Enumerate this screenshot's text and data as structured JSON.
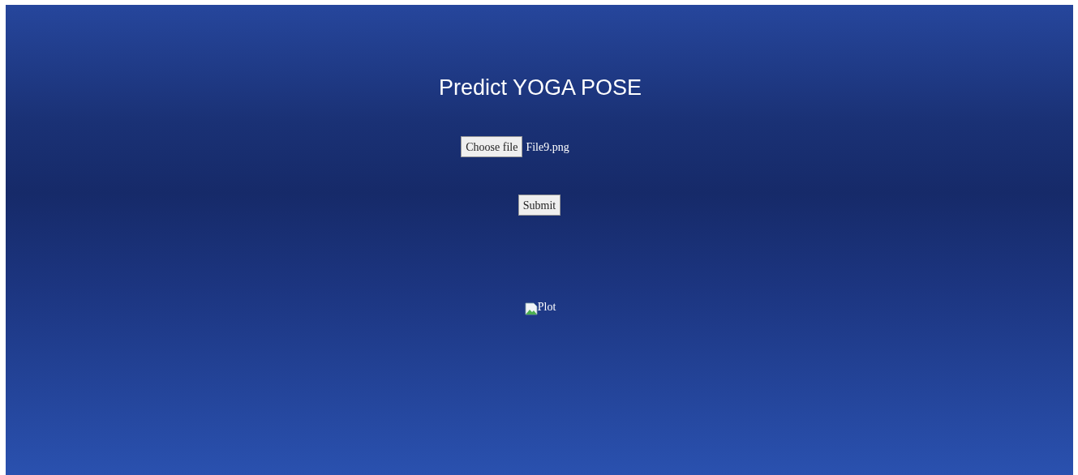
{
  "title": "Predict YOGA POSE",
  "file_input": {
    "button_label": "Choose file",
    "file_name": "File9.png"
  },
  "submit_button": {
    "label": "Submit"
  },
  "result_image": {
    "alt": "Plot"
  }
}
